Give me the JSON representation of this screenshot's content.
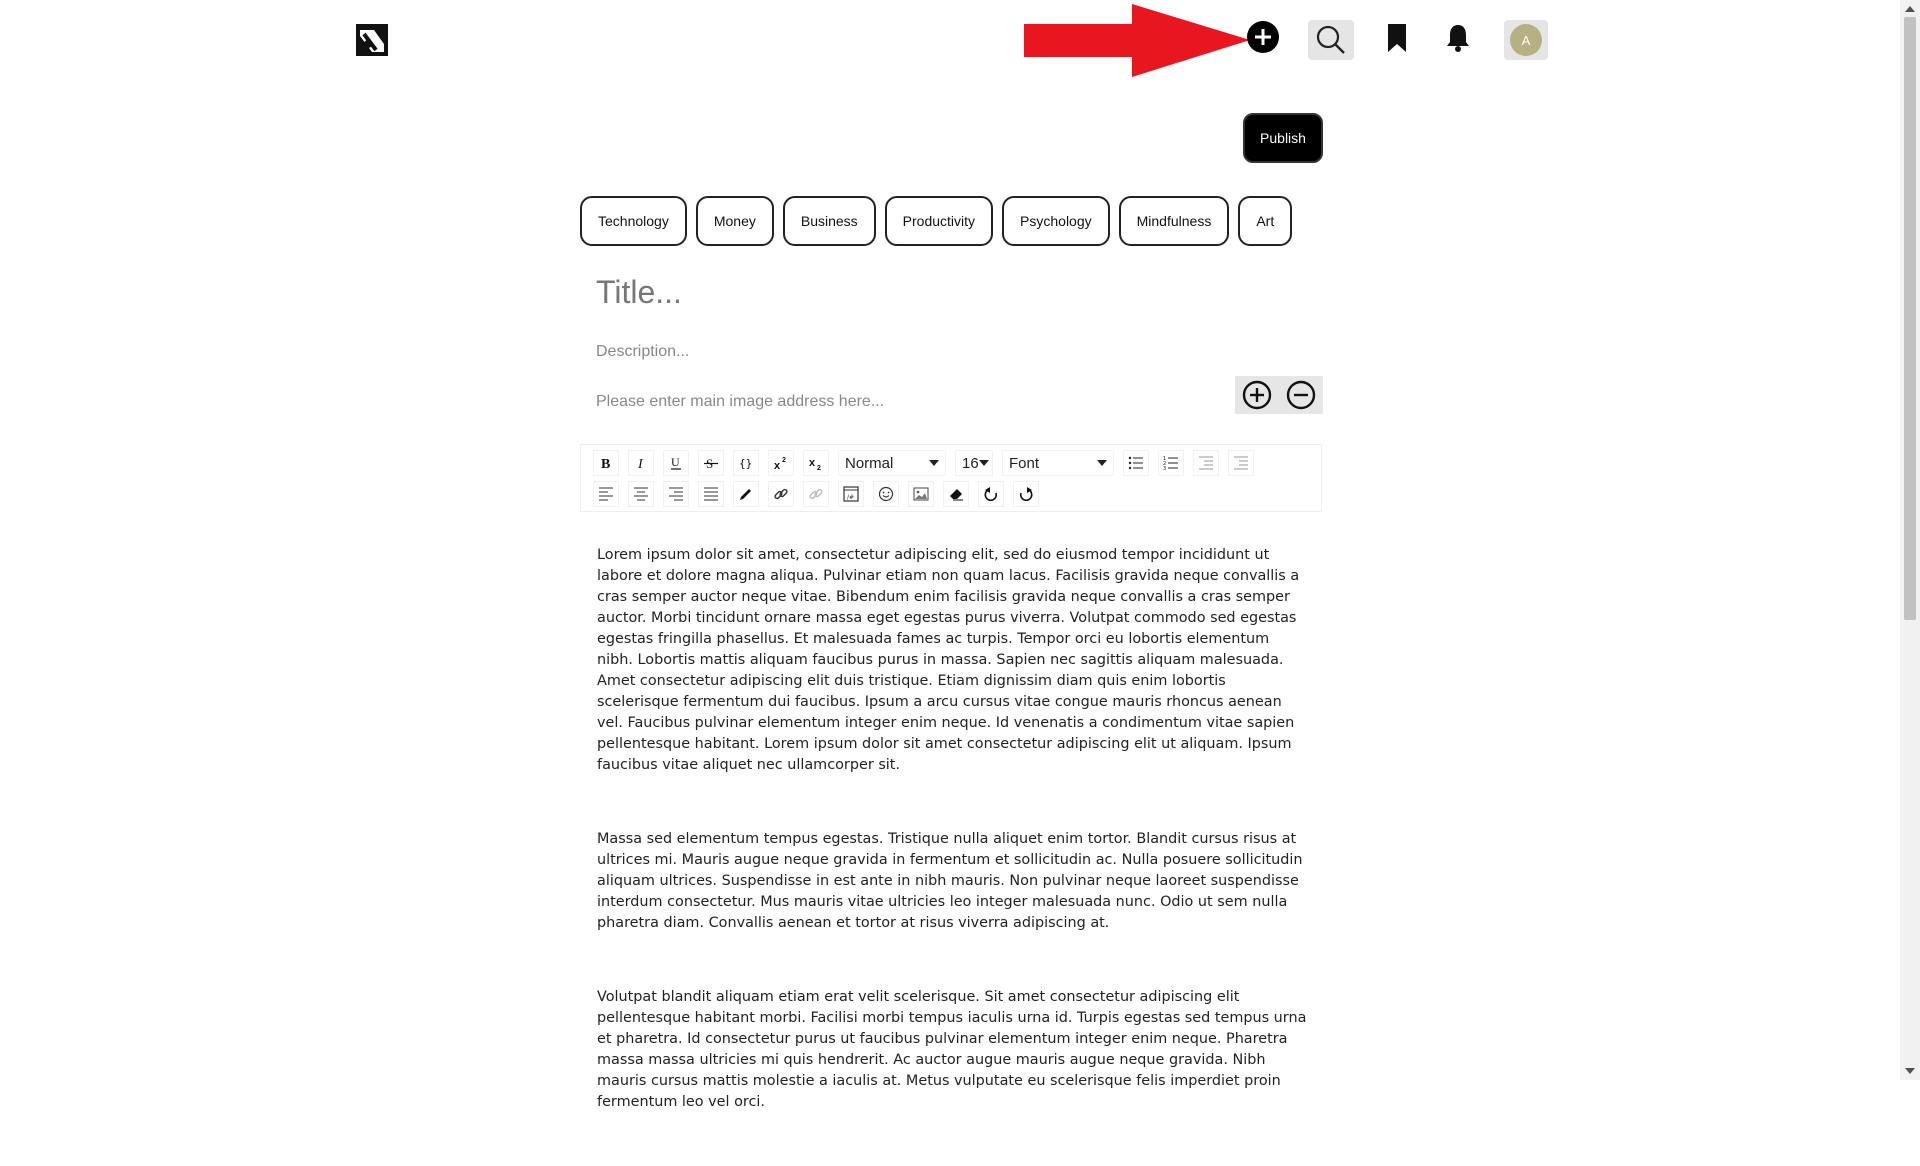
{
  "header": {
    "logo_icon": "medium-style-logo-icon",
    "add_icon": "plus-circle-icon",
    "search_icon": "search-icon",
    "bookmark_icon": "bookmark-icon",
    "bell_icon": "bell-icon",
    "avatar_initial": "A",
    "avatar_color": "#b7b083",
    "annotation_arrow_color": "#e8171f"
  },
  "editor": {
    "publish_label": "Publish",
    "tags": [
      "Technology",
      "Money",
      "Business",
      "Productivity",
      "Psychology",
      "Mindfulness",
      "Art"
    ],
    "title_placeholder": "Title...",
    "description_placeholder": "Description...",
    "image_placeholder": "Please enter main image address here...",
    "image_controls": [
      "plus-circle-icon",
      "minus-circle-icon"
    ],
    "toolbar": {
      "block_type": "Normal",
      "font_size": "16",
      "font_family": "Font",
      "row1_icons": [
        "bold-icon",
        "italic-icon",
        "underline-icon",
        "strikethrough-icon",
        "code-icon",
        "superscript-icon",
        "subscript-icon"
      ],
      "row1_after_icons": [
        "unordered-list-icon",
        "ordered-list-icon",
        "outdent-icon",
        "indent-icon"
      ],
      "row2_icons": [
        "align-left-icon",
        "align-center-icon",
        "align-right-icon",
        "align-justify-icon",
        "color-picker-icon",
        "link-icon",
        "unlink-icon",
        "embed-icon",
        "emoji-icon",
        "image-icon",
        "eraser-icon",
        "undo-icon",
        "redo-icon"
      ]
    },
    "paragraphs": [
      "Lorem ipsum dolor sit amet, consectetur adipiscing elit, sed do eiusmod tempor incididunt ut labore et dolore magna aliqua. Pulvinar etiam non quam lacus. Facilisis gravida neque convallis a cras semper auctor neque vitae. Bibendum enim facilisis gravida neque convallis a cras semper auctor. Morbi tincidunt ornare massa eget egestas purus viverra. Volutpat commodo sed egestas egestas fringilla phasellus. Et malesuada fames ac turpis. Tempor orci eu lobortis elementum nibh. Lobortis mattis aliquam faucibus purus in massa. Sapien nec sagittis aliquam malesuada. Amet consectetur adipiscing elit duis tristique. Etiam dignissim diam quis enim lobortis scelerisque fermentum dui faucibus. Ipsum a arcu cursus vitae congue mauris rhoncus aenean vel. Faucibus pulvinar elementum integer enim neque. Id venenatis a condimentum vitae sapien pellentesque habitant. Lorem ipsum dolor sit amet consectetur adipiscing elit ut aliquam. Ipsum faucibus vitae aliquet nec ullamcorper sit.",
      "Massa sed elementum tempus egestas. Tristique nulla aliquet enim tortor. Blandit cursus risus at ultrices mi. Mauris augue neque gravida in fermentum et sollicitudin ac. Nulla posuere sollicitudin aliquam ultrices. Suspendisse in est ante in nibh mauris. Non pulvinar neque laoreet suspendisse interdum consectetur. Mus mauris vitae ultricies leo integer malesuada nunc. Odio ut sem nulla pharetra diam. Convallis aenean et tortor at risus viverra adipiscing at.",
      "Volutpat blandit aliquam etiam erat velit scelerisque. Sit amet consectetur adipiscing elit pellentesque habitant morbi. Facilisi morbi tempus iaculis urna id. Turpis egestas sed tempus urna et pharetra. Id consectetur purus ut faucibus pulvinar elementum integer enim neque. Pharetra massa massa ultricies mi quis hendrerit. Ac auctor augue mauris augue neque gravida. Nibh mauris cursus mattis molestie a iaculis at. Metus vulputate eu scelerisque felis imperdiet proin fermentum leo vel orci."
    ]
  }
}
